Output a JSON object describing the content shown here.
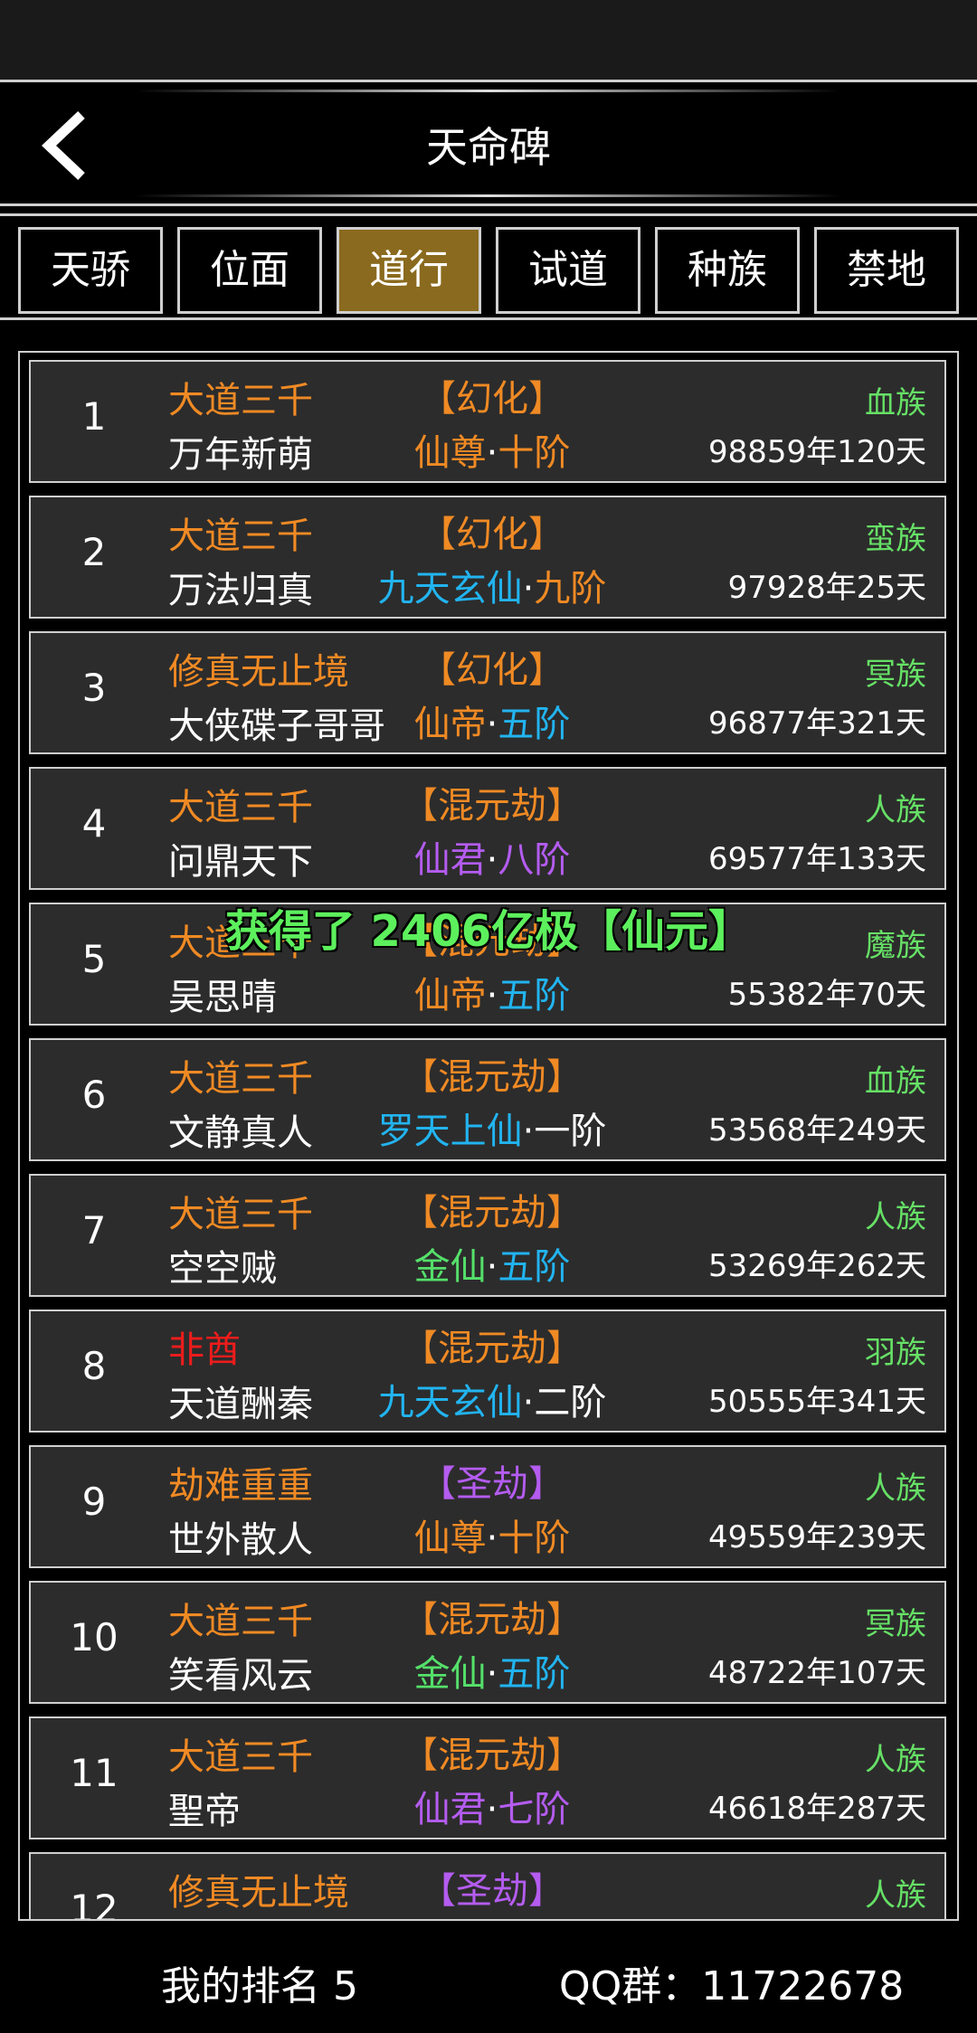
{
  "header": {
    "title": "天命碑"
  },
  "tabs": [
    {
      "label": "天骄",
      "active": false
    },
    {
      "label": "位面",
      "active": false
    },
    {
      "label": "道行",
      "active": true
    },
    {
      "label": "试道",
      "active": false
    },
    {
      "label": "种族",
      "active": false
    },
    {
      "label": "禁地",
      "active": false
    }
  ],
  "colors": {
    "orange": "#f08a24",
    "white": "#ffffff",
    "purple": "#b45cf0",
    "blue": "#22b4f0",
    "green": "#55e06a",
    "red": "#ee1c1c",
    "active_tab": "#8a6a1e"
  },
  "rows": [
    {
      "rank": "1",
      "sect": "大道三千",
      "sect_color": "orange",
      "name": "万年新萌",
      "kalpa": "【幻化】",
      "kalpa_color": "orange",
      "realm": "仙尊",
      "realm_color": "orange",
      "stage": "十阶",
      "stage_color": "orange",
      "race": "血族",
      "age": "98859年120天"
    },
    {
      "rank": "2",
      "sect": "大道三千",
      "sect_color": "orange",
      "name": "万法归真",
      "kalpa": "【幻化】",
      "kalpa_color": "orange",
      "realm": "九天玄仙",
      "realm_color": "blue",
      "stage": "九阶",
      "stage_color": "orange",
      "race": "蛮族",
      "age": "97928年25天"
    },
    {
      "rank": "3",
      "sect": "修真无止境",
      "sect_color": "orange",
      "name": "大侠碟子哥哥",
      "kalpa": "【幻化】",
      "kalpa_color": "orange",
      "realm": "仙帝",
      "realm_color": "orange",
      "stage": "五阶",
      "stage_color": "blue",
      "race": "冥族",
      "age": "96877年321天"
    },
    {
      "rank": "4",
      "sect": "大道三千",
      "sect_color": "orange",
      "name": "问鼎天下",
      "kalpa": "【混元劫】",
      "kalpa_color": "orange",
      "realm": "仙君",
      "realm_color": "purple",
      "stage": "八阶",
      "stage_color": "purple",
      "race": "人族",
      "age": "69577年133天"
    },
    {
      "rank": "5",
      "sect": "大道三千",
      "sect_color": "orange",
      "name": "吴思晴",
      "kalpa": "【混元劫】",
      "kalpa_color": "orange",
      "realm": "仙帝",
      "realm_color": "orange",
      "stage": "五阶",
      "stage_color": "blue",
      "race": "魔族",
      "age": "55382年70天"
    },
    {
      "rank": "6",
      "sect": "大道三千",
      "sect_color": "orange",
      "name": "文静真人",
      "kalpa": "【混元劫】",
      "kalpa_color": "orange",
      "realm": "罗天上仙",
      "realm_color": "blue",
      "stage": "一阶",
      "stage_color": "white",
      "race": "血族",
      "age": "53568年249天"
    },
    {
      "rank": "7",
      "sect": "大道三千",
      "sect_color": "orange",
      "name": "空空贼",
      "kalpa": "【混元劫】",
      "kalpa_color": "orange",
      "realm": "金仙",
      "realm_color": "green",
      "stage": "五阶",
      "stage_color": "blue",
      "race": "人族",
      "age": "53269年262天"
    },
    {
      "rank": "8",
      "sect": "非酋",
      "sect_color": "red",
      "name": "天道酬秦",
      "kalpa": "【混元劫】",
      "kalpa_color": "orange",
      "realm": "九天玄仙",
      "realm_color": "blue",
      "stage": "二阶",
      "stage_color": "white",
      "race": "羽族",
      "age": "50555年341天"
    },
    {
      "rank": "9",
      "sect": "劫难重重",
      "sect_color": "orange",
      "name": "世外散人",
      "kalpa": "【圣劫】",
      "kalpa_color": "purple",
      "realm": "仙尊",
      "realm_color": "orange",
      "stage": "十阶",
      "stage_color": "orange",
      "race": "人族",
      "age": "49559年239天"
    },
    {
      "rank": "10",
      "sect": "大道三千",
      "sect_color": "orange",
      "name": "笑看风云",
      "kalpa": "【混元劫】",
      "kalpa_color": "orange",
      "realm": "金仙",
      "realm_color": "green",
      "stage": "五阶",
      "stage_color": "blue",
      "race": "冥族",
      "age": "48722年107天"
    },
    {
      "rank": "11",
      "sect": "大道三千",
      "sect_color": "orange",
      "name": "聖帝",
      "kalpa": "【混元劫】",
      "kalpa_color": "orange",
      "realm": "仙君",
      "realm_color": "purple",
      "stage": "七阶",
      "stage_color": "purple",
      "race": "人族",
      "age": "46618年287天"
    },
    {
      "rank": "12",
      "sect": "修真无止境",
      "sect_color": "orange",
      "name": "",
      "kalpa": "【圣劫】",
      "kalpa_color": "purple",
      "realm": "",
      "realm_color": "white",
      "stage": "",
      "stage_color": "white",
      "race": "人族",
      "age": ""
    }
  ],
  "separator": "·",
  "toast": "获得了 2406亿极【仙元】",
  "footer": {
    "my_rank": "我的排名 5",
    "qq_group": "QQ群：11722678"
  }
}
